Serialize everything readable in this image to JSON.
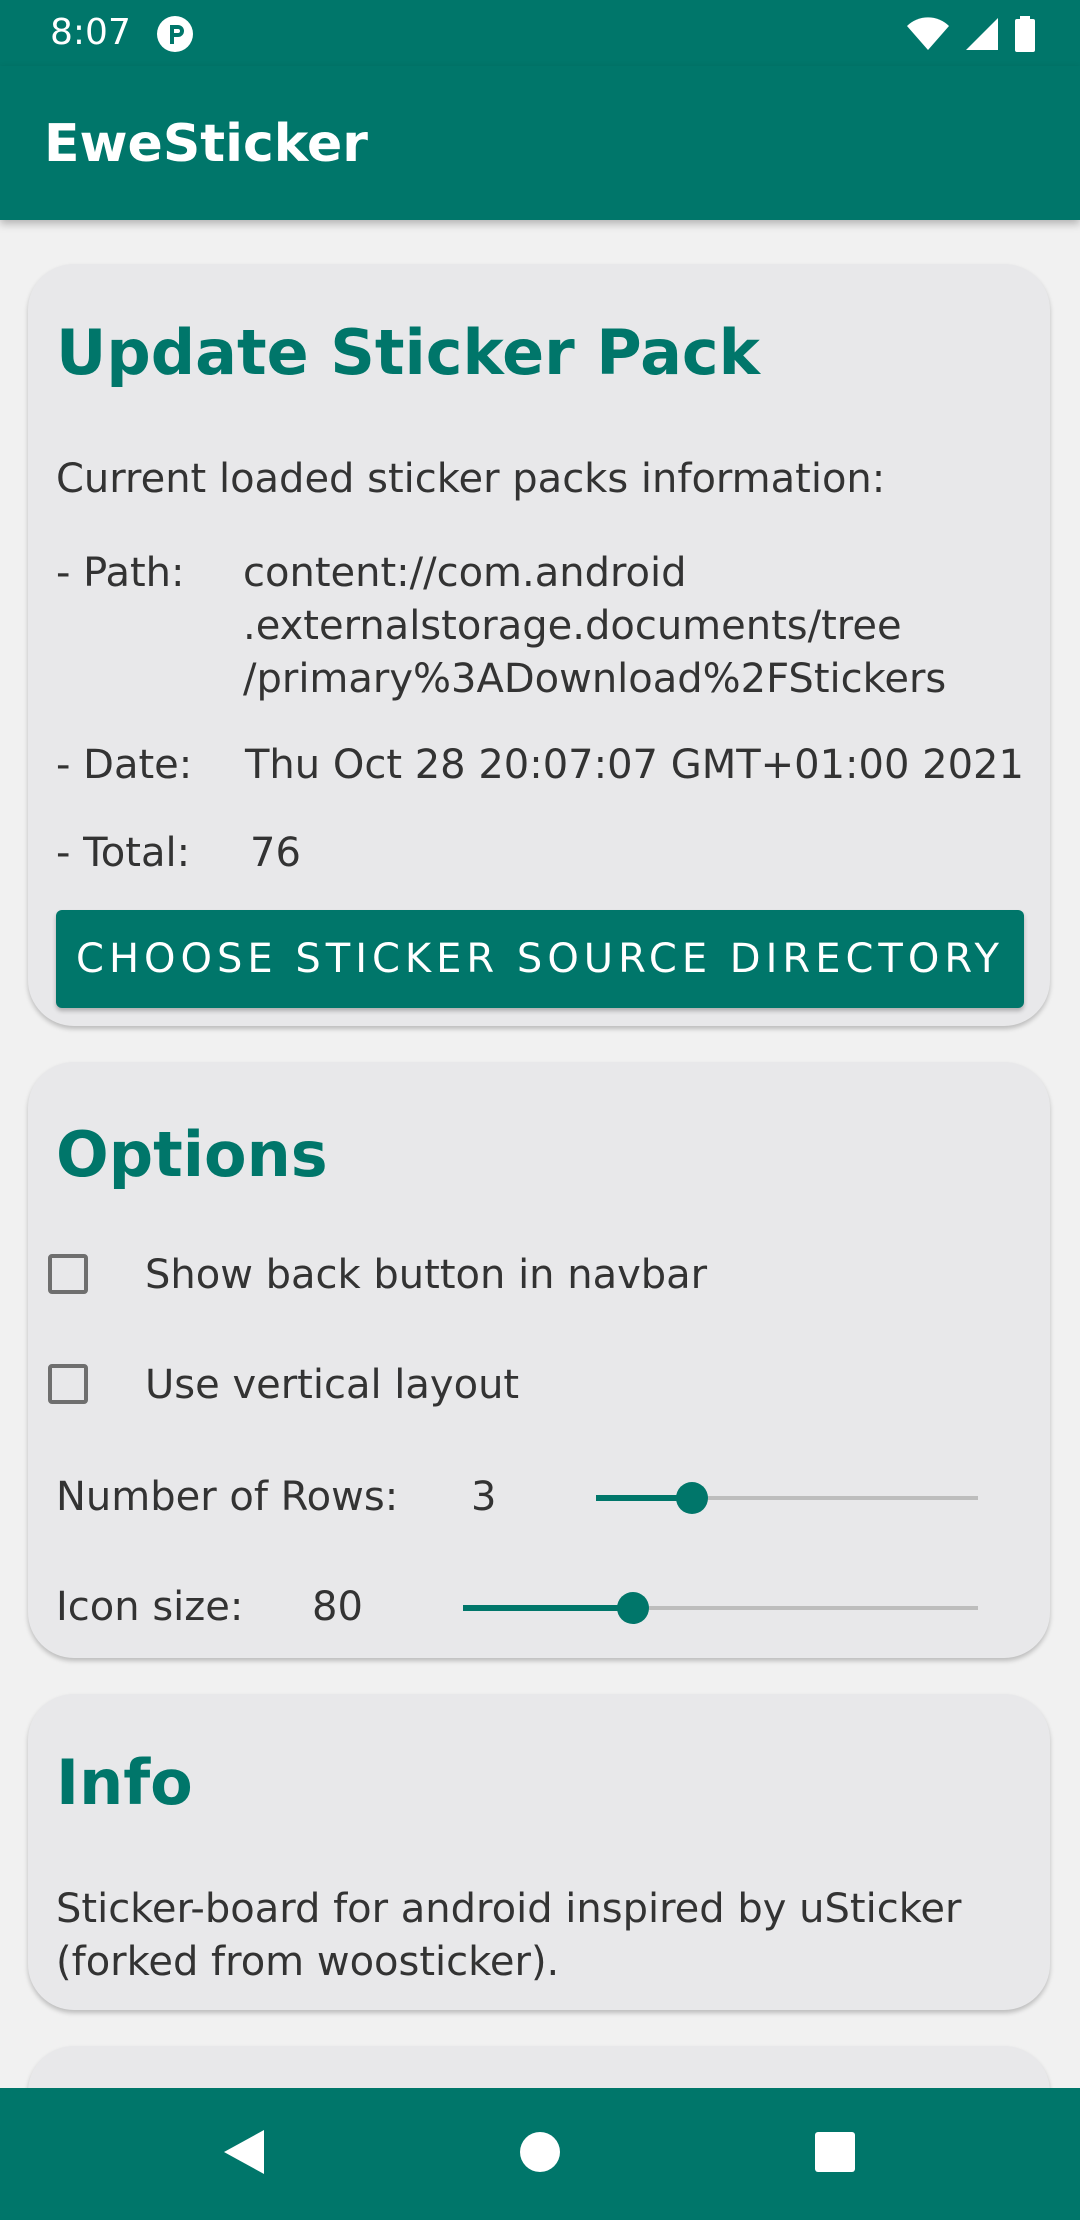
{
  "status_bar": {
    "time": "8:07"
  },
  "app_bar": {
    "title": "EweSticker"
  },
  "update_card": {
    "title": "Update Sticker Pack",
    "intro": "Current loaded sticker packs information:",
    "path_label": "- Path:",
    "path_lines": [
      "content://com.android",
      ".externalstorage.documents/tree",
      "/primary%3ADownload%2FStickers"
    ],
    "date_label": "- Date:",
    "date_value": "Thu Oct 28 20:07:07 GMT+01:00 2021",
    "total_label": "- Total:",
    "total_value": "76",
    "button_label": "CHOOSE STICKER SOURCE DIRECTORY"
  },
  "options_card": {
    "title": "Options",
    "checkboxes": [
      {
        "label": "Show back button in navbar",
        "checked": false
      },
      {
        "label": "Use vertical layout",
        "checked": false
      }
    ],
    "rows_label": "Number of Rows:",
    "rows_value": "3",
    "rows_slider_level": 0.25,
    "icon_label": "Icon size:",
    "icon_value": "80",
    "icon_slider_level": 0.33
  },
  "info_card": {
    "title": "Info",
    "lines": [
      "Sticker-board for android inspired by uSticker",
      "(forked from woosticker)."
    ]
  },
  "nav_bar": {
    "back": "back-icon",
    "home": "home-icon",
    "recents": "recents-icon"
  },
  "colors": {
    "primary": "#00766a",
    "background": "#f1f1f1",
    "card": "#e8e8ea"
  }
}
